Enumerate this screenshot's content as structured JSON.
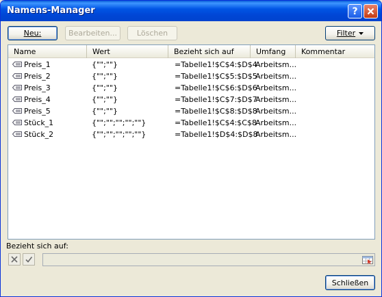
{
  "window": {
    "title": "Namens-Manager"
  },
  "toolbar": {
    "new_label": "Neu:",
    "edit_label": "Bearbeiten...",
    "delete_label": "Löschen",
    "filter_label": "Filter"
  },
  "columns": [
    "Name",
    "Wert",
    "Bezieht sich auf",
    "Umfang",
    "Kommentar"
  ],
  "rows": [
    {
      "name": "Preis_1",
      "value": "{\"\";\"\"}",
      "ref": "=Tabelle1!$C$4:$D$4",
      "scope": "Arbeitsm...",
      "comment": ""
    },
    {
      "name": "Preis_2",
      "value": "{\"\";\"\"}",
      "ref": "=Tabelle1!$C$5:$D$5",
      "scope": "Arbeitsm...",
      "comment": ""
    },
    {
      "name": "Preis_3",
      "value": "{\"\";\"\"}",
      "ref": "=Tabelle1!$C$6:$D$6",
      "scope": "Arbeitsm...",
      "comment": ""
    },
    {
      "name": "Preis_4",
      "value": "{\"\";\"\"}",
      "ref": "=Tabelle1!$C$7:$D$7",
      "scope": "Arbeitsm...",
      "comment": ""
    },
    {
      "name": "Preis_5",
      "value": "{\"\";\"\"}",
      "ref": "=Tabelle1!$C$8:$D$8",
      "scope": "Arbeitsm...",
      "comment": ""
    },
    {
      "name": "Stück_1",
      "value": "{\"\";\"\";\"\";\"\";\"\"}",
      "ref": "=Tabelle1!$C$4:$C$8",
      "scope": "Arbeitsm...",
      "comment": ""
    },
    {
      "name": "Stück_2",
      "value": "{\"\";\"\";\"\";\"\";\"\"}",
      "ref": "=Tabelle1!$D$4:$D$8",
      "scope": "Arbeitsm...",
      "comment": ""
    }
  ],
  "refers_to": {
    "label": "Bezieht sich auf:",
    "value": ""
  },
  "footer": {
    "close_label": "Schließen"
  }
}
